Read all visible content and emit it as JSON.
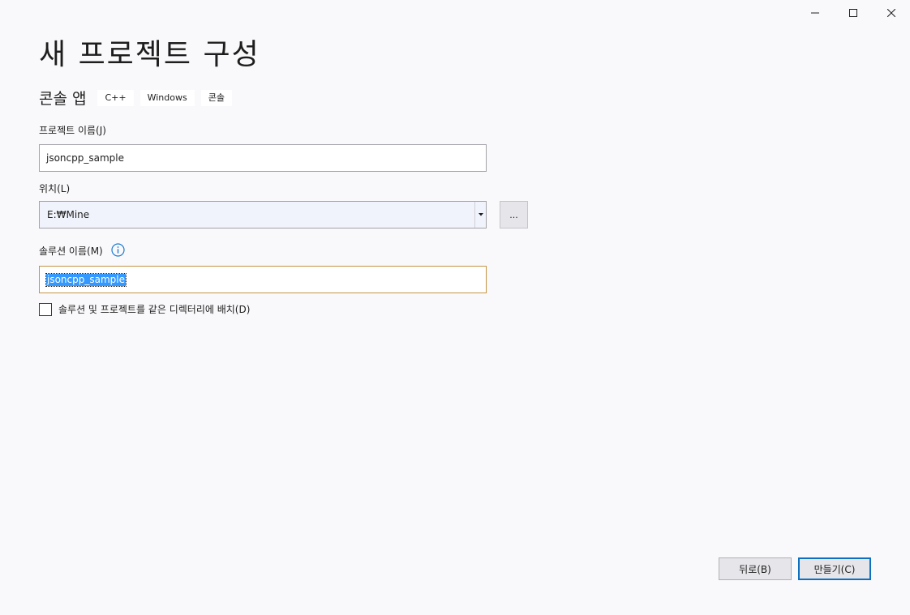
{
  "window": {
    "controls": {
      "minimize": "minimize-icon",
      "maximize": "maximize-icon",
      "close": "close-icon"
    }
  },
  "header": {
    "title": "새 프로젝트 구성",
    "template_name": "콘솔 앱",
    "tags": [
      "C++",
      "Windows",
      "콘솔"
    ]
  },
  "form": {
    "project_name": {
      "label": "프로젝트 이름(J)",
      "value": "jsoncpp_sample"
    },
    "location": {
      "label": "위치(L)",
      "value": "E:₩Mine",
      "browse_label": "..."
    },
    "solution_name": {
      "label": "솔루션 이름(M)",
      "value": "jsoncpp_sample",
      "info_icon": "info-icon"
    },
    "same_directory": {
      "label": "솔루션 및 프로젝트를 같은 디렉터리에 배치(D)",
      "checked": false
    }
  },
  "footer": {
    "back_label": "뒤로(B)",
    "create_label": "만들기(C)"
  },
  "colors": {
    "background": "#f9f9fb",
    "focus_border": "#c49546",
    "selection": "#3399ff",
    "info_blue": "#1f7ad1",
    "default_button_border": "#0e70c0"
  }
}
